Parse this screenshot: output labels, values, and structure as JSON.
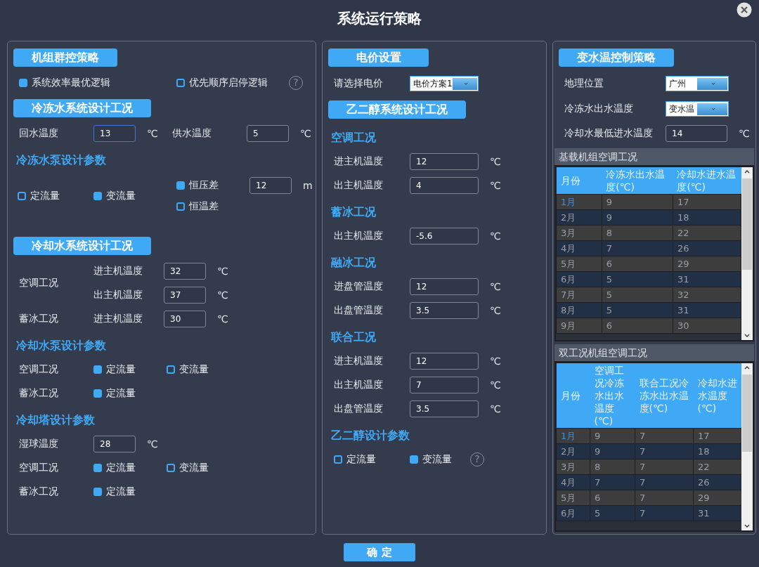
{
  "window": {
    "title": "系统运行策略"
  },
  "panels": [
    {
      "items": [
        {
          "kind": "header",
          "text": "机组群控策略"
        },
        {
          "kind": "checks",
          "options": [
            {
              "label": "系统效率最优逻辑",
              "checked": true
            },
            {
              "label": "优先顺序启停逻辑",
              "checked": false
            }
          ],
          "help": "?"
        },
        {
          "kind": "header",
          "text": "冷冻水系统设计工况"
        },
        {
          "kind": "input",
          "fields": [
            {
              "label": "回水温度",
              "value": "13",
              "unit": "℃",
              "focused": true
            },
            {
              "label": "供水温度",
              "value": "5",
              "unit": "℃",
              "focused": false
            }
          ]
        },
        {
          "kind": "subheading",
          "text": "冷冻水泵设计参数"
        },
        {
          "kind": "pump",
          "options": [
            {
              "label": "定流量",
              "checked": false
            },
            {
              "label": "变流量",
              "checked": true
            }
          ],
          "modes": [
            {
              "label": "恒压差",
              "checked": true,
              "value": "12",
              "unit": "m"
            },
            {
              "label": "恒温差",
              "checked": false
            }
          ]
        },
        {
          "kind": "header",
          "text": "冷却水系统设计工况"
        },
        {
          "kind": "group",
          "label": "空调工况",
          "fields": [
            {
              "label": "进主机温度",
              "value": "32",
              "unit": "℃"
            },
            {
              "label": "出主机温度",
              "value": "37",
              "unit": "℃"
            }
          ]
        },
        {
          "kind": "group",
          "label": "蓄冰工况",
          "fields": [
            {
              "label": "进主机温度",
              "value": "30",
              "unit": "℃"
            }
          ]
        },
        {
          "kind": "subheading",
          "text": "冷却水泵设计参数"
        },
        {
          "kind": "checks",
          "label": "空调工况",
          "options": [
            {
              "label": "定流量",
              "checked": true
            },
            {
              "label": "变流量",
              "checked": false
            }
          ]
        },
        {
          "kind": "checks",
          "label": "蓄冰工况",
          "options": [
            {
              "label": "定流量",
              "checked": true
            }
          ]
        },
        {
          "kind": "subheading",
          "text": "冷却塔设计参数"
        },
        {
          "kind": "input",
          "fields": [
            {
              "label": "湿球温度",
              "value": "28",
              "unit": "℃",
              "focused": false
            }
          ]
        },
        {
          "kind": "checks",
          "label": "空调工况",
          "options": [
            {
              "label": "定流量",
              "checked": true
            },
            {
              "label": "变流量",
              "checked": false
            }
          ]
        },
        {
          "kind": "checks",
          "label": "蓄冰工况",
          "options": [
            {
              "label": "定流量",
              "checked": true
            }
          ]
        }
      ]
    },
    {
      "items": [
        {
          "kind": "header",
          "text": "电价设置"
        },
        {
          "kind": "select",
          "label": "请选择电价",
          "value": "电价方案1"
        },
        {
          "kind": "header",
          "text": "乙二醇系统设计工况"
        },
        {
          "kind": "subheading",
          "text": "空调工况"
        },
        {
          "kind": "input",
          "fields": [
            {
              "label": "进主机温度",
              "value": "12",
              "unit": "℃",
              "focused": false
            }
          ]
        },
        {
          "kind": "input",
          "fields": [
            {
              "label": "出主机温度",
              "value": "4",
              "unit": "℃",
              "focused": false
            }
          ]
        },
        {
          "kind": "subheading",
          "text": "蓄冰工况"
        },
        {
          "kind": "input",
          "fields": [
            {
              "label": "出主机温度",
              "value": "-5.6",
              "unit": "℃",
              "focused": false
            }
          ]
        },
        {
          "kind": "subheading",
          "text": "融冰工况"
        },
        {
          "kind": "input",
          "fields": [
            {
              "label": "进盘管温度",
              "value": "12",
              "unit": "℃",
              "focused": false
            }
          ]
        },
        {
          "kind": "input",
          "fields": [
            {
              "label": "出盘管温度",
              "value": "3.5",
              "unit": "℃",
              "focused": false
            }
          ]
        },
        {
          "kind": "subheading",
          "text": "联合工况"
        },
        {
          "kind": "input",
          "fields": [
            {
              "label": "进主机温度",
              "value": "12",
              "unit": "℃",
              "focused": false
            }
          ]
        },
        {
          "kind": "input",
          "fields": [
            {
              "label": "出主机温度",
              "value": "7",
              "unit": "℃",
              "focused": false
            }
          ]
        },
        {
          "kind": "input",
          "fields": [
            {
              "label": "出盘管温度",
              "value": "3.5",
              "unit": "℃",
              "focused": false
            }
          ]
        },
        {
          "kind": "subheading",
          "text": "乙二醇设计参数"
        },
        {
          "kind": "checks",
          "options": [
            {
              "label": "定流量",
              "checked": false
            },
            {
              "label": "变流量",
              "checked": true
            }
          ],
          "help": "?"
        }
      ]
    },
    {
      "items": [
        {
          "kind": "header",
          "text": "变水温控制策略"
        },
        {
          "kind": "select",
          "label": "地理位置",
          "value": "广州"
        },
        {
          "kind": "select",
          "label": "冷冻水出水温度",
          "value": "变水温"
        },
        {
          "kind": "input",
          "fields": [
            {
              "label": "冷却水最低进水温度",
              "value": "14",
              "unit": "℃",
              "focused": false
            }
          ]
        },
        {
          "kind": "table",
          "title": "基载机组空调工况",
          "columns": [
            "月份",
            "冷冻水出水温度(℃)",
            "冷却水进水温度(℃)"
          ],
          "rows": [
            {
              "selected": true,
              "cells": [
                "1月",
                "9",
                "17"
              ]
            },
            {
              "selected": false,
              "cells": [
                "2月",
                "9",
                "18"
              ]
            },
            {
              "selected": false,
              "cells": [
                "3月",
                "8",
                "22"
              ]
            },
            {
              "selected": false,
              "cells": [
                "4月",
                "7",
                "26"
              ]
            },
            {
              "selected": false,
              "cells": [
                "5月",
                "6",
                "29"
              ]
            },
            {
              "selected": false,
              "cells": [
                "6月",
                "5",
                "31"
              ]
            },
            {
              "selected": false,
              "cells": [
                "7月",
                "5",
                "32"
              ]
            },
            {
              "selected": false,
              "cells": [
                "8月",
                "5",
                "31"
              ]
            },
            {
              "selected": false,
              "cells": [
                "9月",
                "6",
                "30"
              ]
            }
          ]
        },
        {
          "kind": "table",
          "title": "双工况机组空调工况",
          "columns": [
            "月份",
            "空调工况冷冻水出水温度(℃)",
            "联合工况冷冻水出水温度(℃)",
            "冷却水进水温度(℃)"
          ],
          "rows": [
            {
              "selected": true,
              "cells": [
                "1月",
                "9",
                "7",
                "17"
              ]
            },
            {
              "selected": false,
              "cells": [
                "2月",
                "9",
                "7",
                "18"
              ]
            },
            {
              "selected": false,
              "cells": [
                "3月",
                "8",
                "7",
                "22"
              ]
            },
            {
              "selected": false,
              "cells": [
                "4月",
                "7",
                "7",
                "26"
              ]
            },
            {
              "selected": false,
              "cells": [
                "5月",
                "6",
                "7",
                "29"
              ]
            },
            {
              "selected": false,
              "cells": [
                "6月",
                "5",
                "7",
                "31"
              ]
            }
          ]
        }
      ]
    }
  ],
  "confirm_button": "确 定"
}
